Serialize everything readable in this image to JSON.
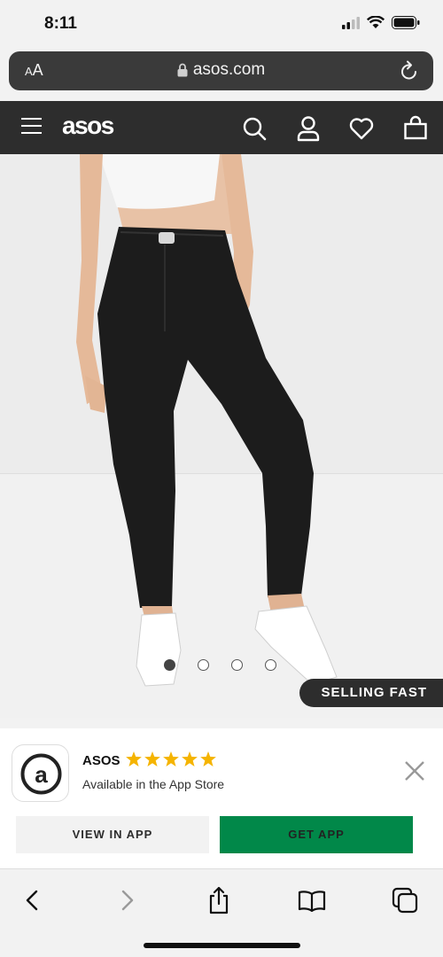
{
  "status_bar": {
    "time": "8:11",
    "icons": [
      "cellular-signal-icon",
      "wifi-icon",
      "battery-icon"
    ]
  },
  "url_bar": {
    "text_size_label_small": "A",
    "text_size_label_large": "A",
    "domain": "asos.com",
    "icons": [
      "lock-icon",
      "reload-icon"
    ]
  },
  "header": {
    "brand": "asos",
    "icons": [
      "menu-icon",
      "search-icon",
      "account-icon",
      "wishlist-icon",
      "bag-icon"
    ]
  },
  "product": {
    "image_description": "model wearing black mom jeans",
    "carousel": {
      "total": 4,
      "active_index": 0
    },
    "badge": "SELLING FAST"
  },
  "app_banner": {
    "app_name": "ASOS",
    "rating_stars": 5,
    "subtitle": "Available in the App Store",
    "view_button": "VIEW IN APP",
    "get_button": "GET APP"
  },
  "toolbar": {
    "icons": [
      "back-icon",
      "forward-icon",
      "share-icon",
      "bookmarks-icon",
      "tabs-icon"
    ]
  },
  "colors": {
    "header_bg": "#2d2d2d",
    "get_app_green": "#018849",
    "star_gold": "#f5b400",
    "jeans": "#1c1c1c"
  }
}
